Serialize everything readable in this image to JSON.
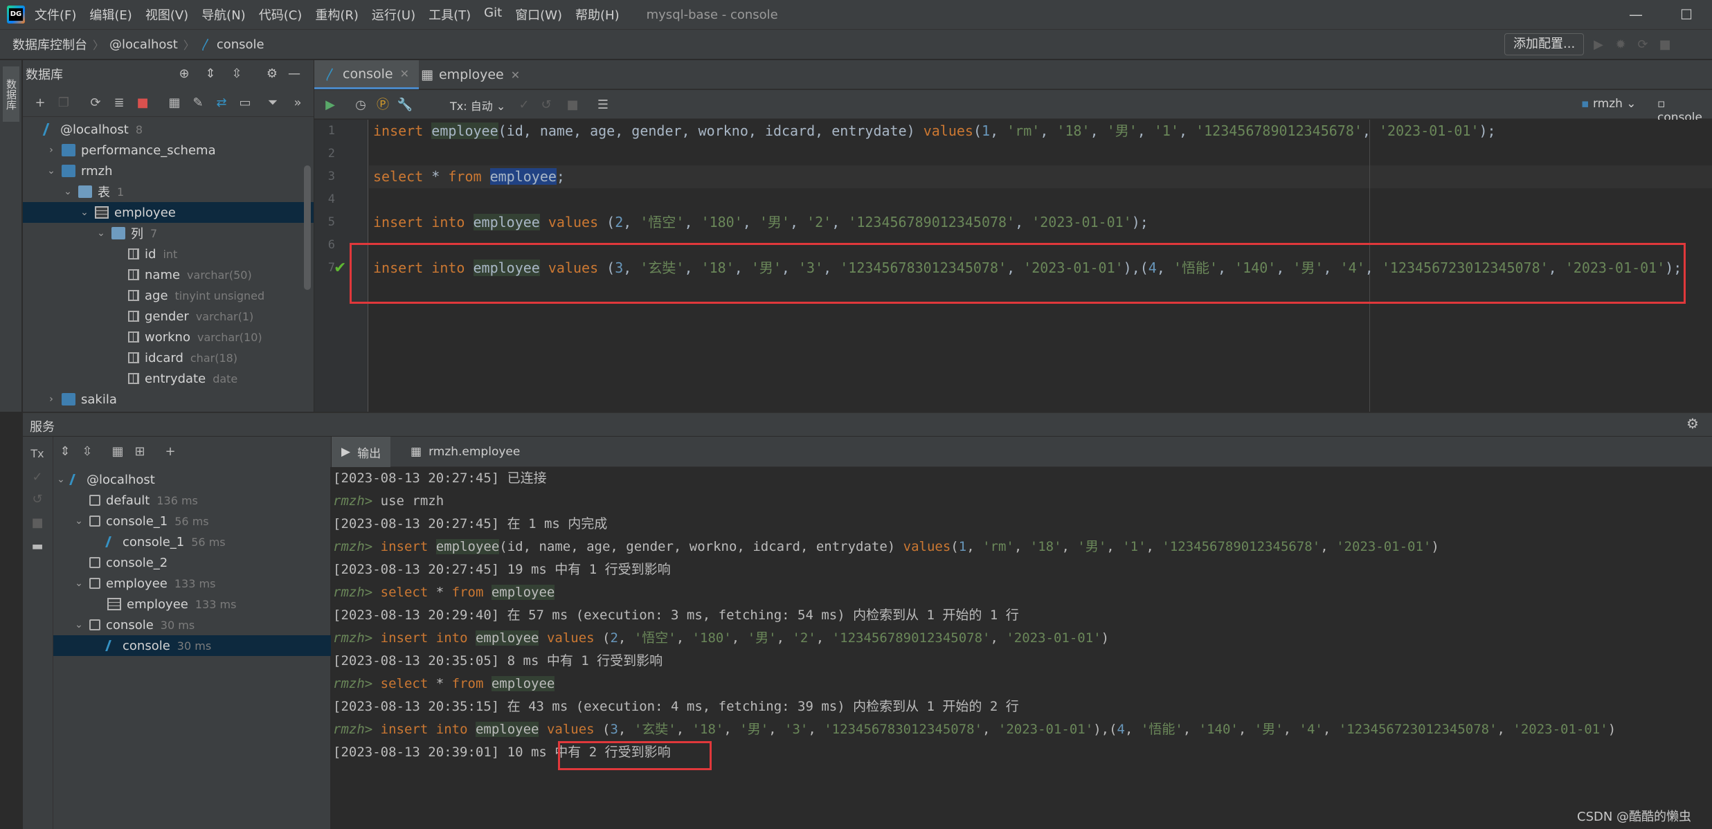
{
  "app": {
    "logo": "datagrip-logo",
    "window_title": "mysql-base - console"
  },
  "menu": [
    "文件(F)",
    "编辑(E)",
    "视图(V)",
    "导航(N)",
    "代码(C)",
    "重构(R)",
    "运行(U)",
    "工具(T)",
    "Git",
    "窗口(W)",
    "帮助(H)"
  ],
  "window_controls": {
    "minimize": "—",
    "maximize": "☐"
  },
  "breadcrumb": [
    "数据库控制台",
    "@localhost",
    "console"
  ],
  "nav": {
    "add_config": "添加配置..."
  },
  "left_strip": {
    "label": "数据库"
  },
  "db_panel": {
    "title": "数据库",
    "tree": [
      {
        "label": "@localhost",
        "meta": "8",
        "icon": "host",
        "depth": 0,
        "toggle": ""
      },
      {
        "label": "performance_schema",
        "meta": "",
        "icon": "schema",
        "depth": 1,
        "toggle": "›"
      },
      {
        "label": "rmzh",
        "meta": "",
        "icon": "schema",
        "depth": 1,
        "toggle": "⌄"
      },
      {
        "label": "表",
        "meta": "1",
        "icon": "folder",
        "depth": 2,
        "toggle": "⌄"
      },
      {
        "label": "employee",
        "meta": "",
        "icon": "table",
        "depth": 3,
        "toggle": "⌄",
        "selected": true
      },
      {
        "label": "列",
        "meta": "7",
        "icon": "folder",
        "depth": 4,
        "toggle": "⌄"
      },
      {
        "label": "id",
        "meta": "int",
        "icon": "col",
        "depth": 5,
        "toggle": ""
      },
      {
        "label": "name",
        "meta": "varchar(50)",
        "icon": "col",
        "depth": 5,
        "toggle": ""
      },
      {
        "label": "age",
        "meta": "tinyint unsigned",
        "icon": "col",
        "depth": 5,
        "toggle": ""
      },
      {
        "label": "gender",
        "meta": "varchar(1)",
        "icon": "col",
        "depth": 5,
        "toggle": ""
      },
      {
        "label": "workno",
        "meta": "varchar(10)",
        "icon": "col",
        "depth": 5,
        "toggle": ""
      },
      {
        "label": "idcard",
        "meta": "char(18)",
        "icon": "col",
        "depth": 5,
        "toggle": ""
      },
      {
        "label": "entrydate",
        "meta": "date",
        "icon": "col",
        "depth": 5,
        "toggle": ""
      },
      {
        "label": "sakila",
        "meta": "",
        "icon": "schema",
        "depth": 1,
        "toggle": "›"
      }
    ]
  },
  "editor": {
    "tabs": [
      {
        "label": "console",
        "active": true
      },
      {
        "label": "employee",
        "active": false
      }
    ],
    "tx_mode": "Tx: 自动",
    "schema_selector": "rmzh",
    "console_selector": "console",
    "line_numbers": [
      "1",
      "2",
      "3",
      "4",
      "5",
      "6",
      "7"
    ],
    "lines": [
      "insert employee(id, name, age, gender, workno, idcard, entrydate) values(1, 'rm', '18', '男', '1', '123456789012345678', '2023-01-01');",
      "",
      "select * from employee;",
      "",
      "insert into employee values (2, '悟空', '180', '男', '2', '123456789012345078', '2023-01-01');",
      "",
      "insert into employee values (3, '玄奘', '18', '男', '3', '123456783012345078', '2023-01-01'),(4, '悟能', '140', '男', '4', '123456723012345078', '2023-01-01');"
    ]
  },
  "services": {
    "title": "服务",
    "toolbar_tx": "Tx",
    "tree": [
      {
        "label": "@localhost",
        "meta": "",
        "icon": "con",
        "depth": 0,
        "toggle": "⌄"
      },
      {
        "label": "default",
        "meta": "136 ms",
        "icon": "sess",
        "depth": 1,
        "toggle": ""
      },
      {
        "label": "console_1",
        "meta": "56 ms",
        "icon": "sess",
        "depth": 1,
        "toggle": "⌄"
      },
      {
        "label": "console_1",
        "meta": "56 ms",
        "icon": "con",
        "depth": 2,
        "toggle": ""
      },
      {
        "label": "console_2",
        "meta": "",
        "icon": "sess",
        "depth": 1,
        "toggle": ""
      },
      {
        "label": "employee",
        "meta": "133 ms",
        "icon": "sess",
        "depth": 1,
        "toggle": "⌄"
      },
      {
        "label": "employee",
        "meta": "133 ms",
        "icon": "table",
        "depth": 2,
        "toggle": ""
      },
      {
        "label": "console",
        "meta": "30 ms",
        "icon": "sess",
        "depth": 1,
        "toggle": "⌄"
      },
      {
        "label": "console",
        "meta": "30 ms",
        "icon": "con",
        "depth": 2,
        "toggle": "",
        "selected": true
      }
    ],
    "output_tabs": [
      {
        "label": "输出",
        "active": true
      },
      {
        "label": "rmzh.employee",
        "active": false
      }
    ],
    "output": [
      {
        "type": "log",
        "text": "[2023-08-13 20:27:45] 已连接"
      },
      {
        "type": "cmd",
        "prompt": "rmzh>",
        "text": "use rmzh"
      },
      {
        "type": "log",
        "text": "[2023-08-13 20:27:45] 在 1 ms 内完成"
      },
      {
        "type": "cmd",
        "prompt": "rmzh>",
        "text": "insert employee(id, name, age, gender, workno, idcard, entrydate) values(1, 'rm', '18', '男', '1', '123456789012345678', '2023-01-01')"
      },
      {
        "type": "log",
        "text": "[2023-08-13 20:27:45] 19 ms 中有 1 行受到影响"
      },
      {
        "type": "cmd",
        "prompt": "rmzh>",
        "text": "select * from employee"
      },
      {
        "type": "log",
        "text": "[2023-08-13 20:29:40] 在 57 ms (execution: 3 ms, fetching: 54 ms) 内检索到从 1 开始的 1 行"
      },
      {
        "type": "cmd",
        "prompt": "rmzh>",
        "text": "insert into employee values (2, '悟空', '180', '男', '2', '123456789012345078', '2023-01-01')"
      },
      {
        "type": "log",
        "text": "[2023-08-13 20:35:05] 8 ms 中有 1 行受到影响"
      },
      {
        "type": "cmd",
        "prompt": "rmzh>",
        "text": "select * from employee"
      },
      {
        "type": "log",
        "text": "[2023-08-13 20:35:15] 在 43 ms (execution: 4 ms, fetching: 39 ms) 内检索到从 1 开始的 2 行"
      },
      {
        "type": "cmd",
        "prompt": "rmzh>",
        "text": "insert into employee values (3, '玄奘', '18', '男', '3', '123456783012345078', '2023-01-01'),(4, '悟能', '140', '男', '4', '123456723012345078', '2023-01-01')"
      },
      {
        "type": "log",
        "text": "[2023-08-13 20:39:01] 10 ms 中有 2 行受到影响"
      }
    ]
  },
  "watermark": "CSDN @酷酷的懒虫",
  "colors": {
    "accent": "#4a88c7",
    "highlight_box": "#e0383b",
    "keyword": "#cc7832",
    "string": "#6a8759",
    "number": "#6897bb"
  }
}
